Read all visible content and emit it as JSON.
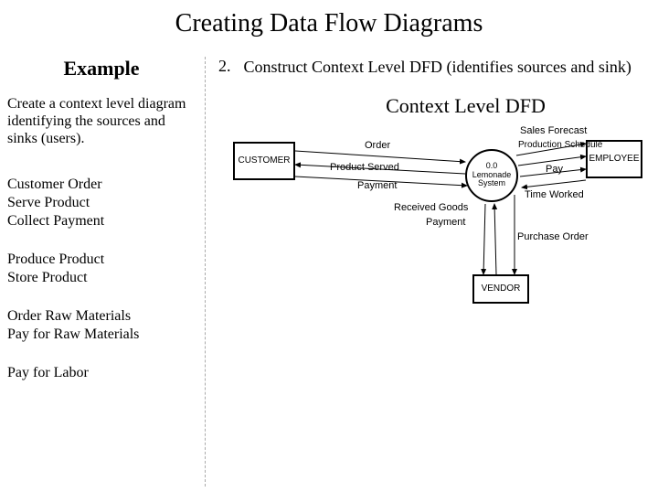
{
  "title": "Creating Data Flow Diagrams",
  "left": {
    "heading": "Example",
    "intro": "Create a context level diagram identifying the sources and sinks (users).",
    "block_customer": "Customer Order\nServe Product\nCollect Payment",
    "block_produce": "Produce Product\nStore Product",
    "block_materials": "Order Raw Materials\nPay for Raw Materials",
    "block_labor": "Pay for Labor"
  },
  "right": {
    "step_num": "2.",
    "step_text": "Construct Context Level DFD (identifies sources and sink)",
    "context_title": "Context Level DFD",
    "entities": {
      "customer": "CUSTOMER",
      "employee": "EMPLOYEE",
      "vendor": "VENDOR"
    },
    "process": {
      "number": "0.0",
      "name": "Lemonade System"
    },
    "flows": {
      "order": "Order",
      "product_served": "Product Served",
      "payment": "Payment",
      "sales_forecast": "Sales Forecast",
      "production_schedule": "Production Schedule",
      "pay": "Pay",
      "time_worked": "Time Worked",
      "received_goods": "Received Goods",
      "payment2": "Payment",
      "purchase_order": "Purchase Order"
    }
  }
}
